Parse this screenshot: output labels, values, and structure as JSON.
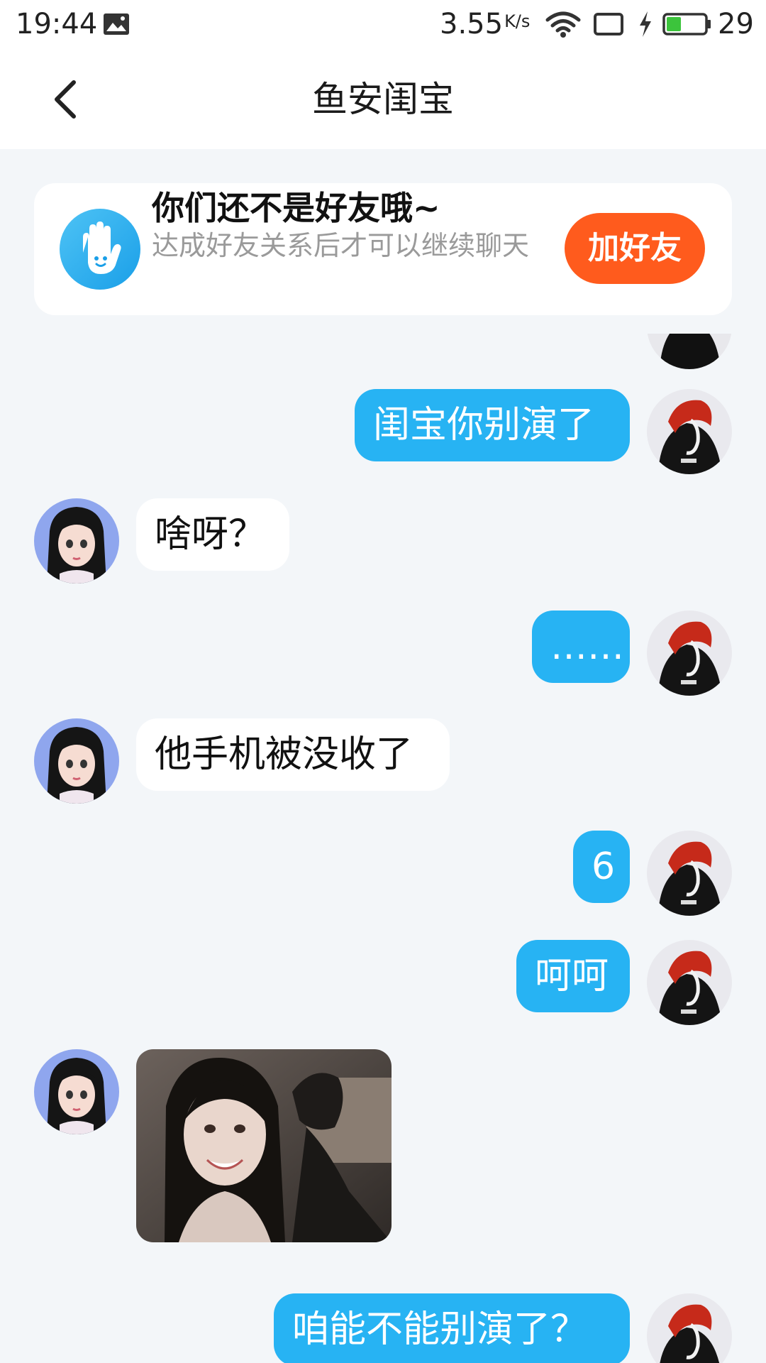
{
  "status_bar": {
    "time": "19:44",
    "net_speed": "3.55",
    "net_unit": "K/s",
    "battery": "29"
  },
  "header": {
    "title": "鱼安闺宝"
  },
  "friend_card": {
    "title": "你们还不是好友哦~",
    "subtitle": "达成好友关系后才可以继续聊天",
    "button": "加好友"
  },
  "messages": [
    {
      "side": "out",
      "text": "闺宝你别演了"
    },
    {
      "side": "in",
      "text": "啥呀？"
    },
    {
      "side": "out",
      "text": "……"
    },
    {
      "side": "in",
      "text": "他手机被没收了"
    },
    {
      "side": "out",
      "text": "6"
    },
    {
      "side": "out",
      "text": "呵呵"
    },
    {
      "side": "in",
      "type": "image"
    },
    {
      "side": "out",
      "text": "咱能不能别演了？"
    }
  ],
  "colors": {
    "accent": "#27b3f3",
    "add_friend": "#ff5b1d",
    "background": "#f3f6f9"
  }
}
